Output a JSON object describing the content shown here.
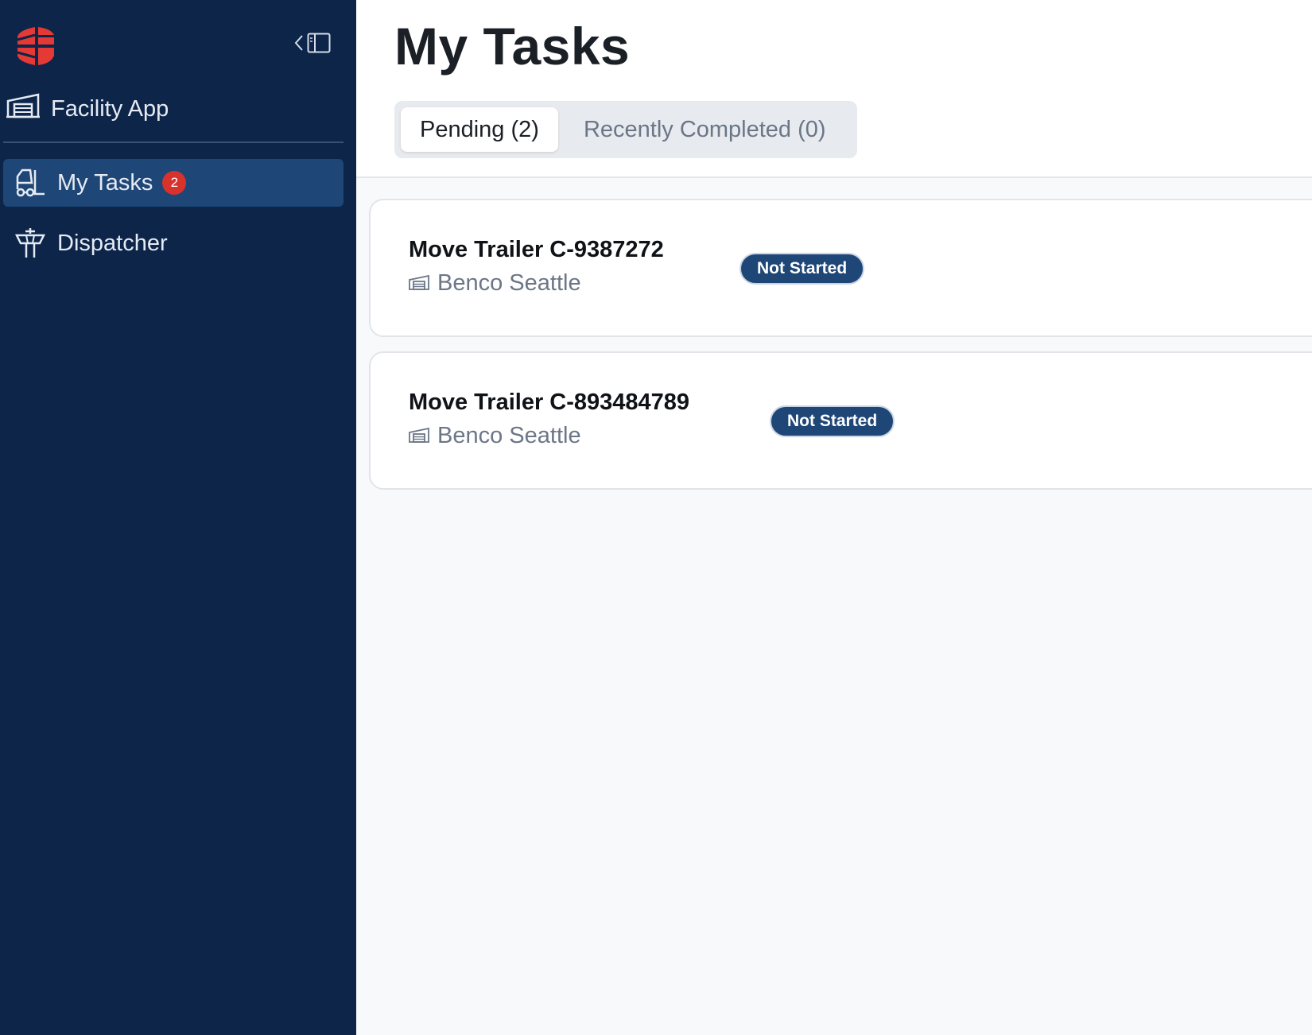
{
  "sidebar": {
    "app_name": "Facility App",
    "items": [
      {
        "label": "My Tasks",
        "badge": "2",
        "active": true,
        "icon": "forklift-icon"
      },
      {
        "label": "Dispatcher",
        "active": false,
        "icon": "control-tower-icon"
      }
    ],
    "collapse_icon": "sidebar-collapse-icon"
  },
  "main": {
    "title": "My Tasks",
    "tabs": [
      {
        "label": "Pending (2)",
        "active": true
      },
      {
        "label": "Recently Completed (0)",
        "active": false
      }
    ],
    "tasks": [
      {
        "title": "Move Trailer C-9387272",
        "facility": "Benco Seattle",
        "status": "Not Started"
      },
      {
        "title": "Move Trailer C-893484789",
        "facility": "Benco Seattle",
        "status": "Not Started"
      }
    ]
  },
  "colors": {
    "sidebar_bg": "#0c2549",
    "nav_active_bg": "#1e4677",
    "badge_red": "#d8322c",
    "status_bg": "#1e4677",
    "logo_red": "#e53935"
  }
}
